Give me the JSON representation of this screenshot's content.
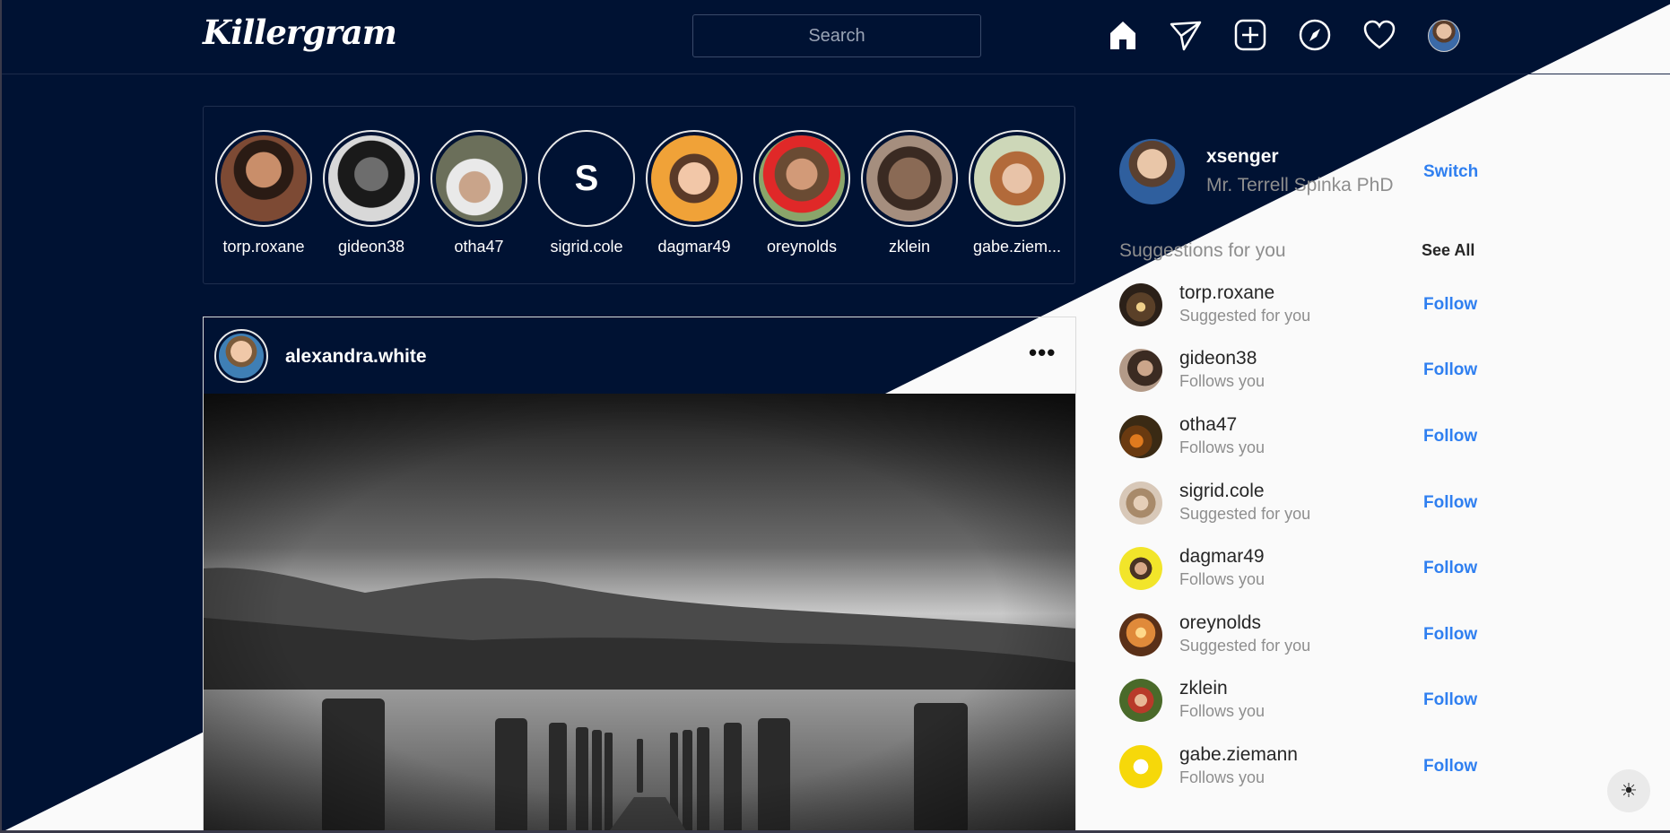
{
  "app": {
    "logo": "Killergram",
    "search_placeholder": "Search"
  },
  "nav": {
    "icons": [
      "home-icon",
      "send-icon",
      "new-post-icon",
      "explore-icon",
      "heart-icon",
      "profile-avatar"
    ]
  },
  "stories": [
    {
      "username": "torp.roxane"
    },
    {
      "username": "gideon38"
    },
    {
      "username": "otha47"
    },
    {
      "username": "sigrid.cole",
      "letter": "S"
    },
    {
      "username": "dagmar49"
    },
    {
      "username": "oreynolds"
    },
    {
      "username": "zklein"
    },
    {
      "username": "gabe.ziem..."
    }
  ],
  "post": {
    "username": "alexandra.white",
    "more": "•••"
  },
  "sidebar": {
    "username": "xsenger",
    "full_name": "Mr. Terrell Spinka PhD",
    "switch_label": "Switch",
    "suggestions_title": "Suggestions for you",
    "see_all_label": "See All",
    "suggestions": [
      {
        "username": "torp.roxane",
        "subtitle": "Suggested for you",
        "action": "Follow"
      },
      {
        "username": "gideon38",
        "subtitle": "Follows you",
        "action": "Follow"
      },
      {
        "username": "otha47",
        "subtitle": "Follows you",
        "action": "Follow"
      },
      {
        "username": "sigrid.cole",
        "subtitle": "Suggested for you",
        "action": "Follow"
      },
      {
        "username": "dagmar49",
        "subtitle": "Follows you",
        "action": "Follow"
      },
      {
        "username": "oreynolds",
        "subtitle": "Suggested for you",
        "action": "Follow"
      },
      {
        "username": "zklein",
        "subtitle": "Follows you",
        "action": "Follow"
      },
      {
        "username": "gabe.ziemann",
        "subtitle": "Follows you",
        "action": "Follow"
      }
    ]
  },
  "theme_toggle": {
    "icon": "sun-icon",
    "glyph": "☀"
  },
  "colors": {
    "dark_bg": "#001233",
    "light_bg": "#fafafa",
    "link": "#2f7ff0"
  }
}
